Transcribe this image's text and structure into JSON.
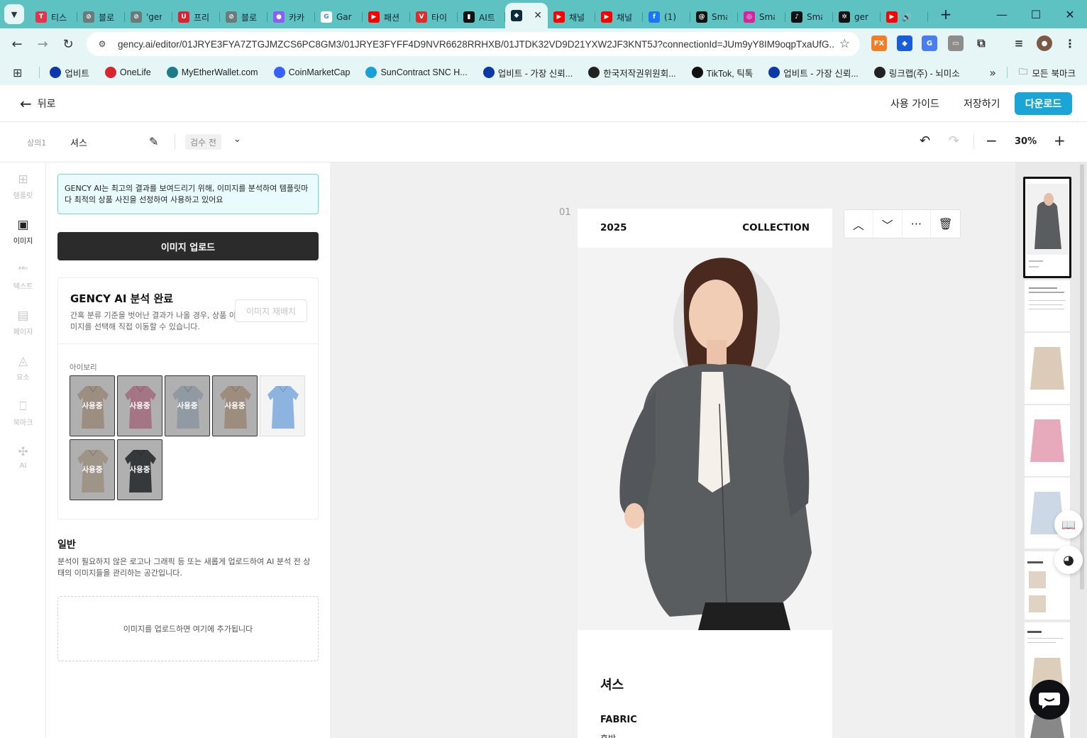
{
  "browser": {
    "tabs": [
      {
        "title": "티스",
        "color": "#e5344a",
        "glyph": "T"
      },
      {
        "title": "블로",
        "color": "#6b7b7b",
        "glyph": "⊘"
      },
      {
        "title": "'ger",
        "color": "#6b7b7b",
        "glyph": "⊘"
      },
      {
        "title": "프리",
        "color": "#e0202e",
        "glyph": "U"
      },
      {
        "title": "블로",
        "color": "#6b7b7b",
        "glyph": "⊘"
      },
      {
        "title": "카카",
        "color": "#8b5cf6",
        "glyph": "●"
      },
      {
        "title": "Gar",
        "color": "#ffffff",
        "glyph": "G"
      },
      {
        "title": "패션",
        "color": "#ff0000",
        "glyph": "▶"
      },
      {
        "title": "타이",
        "color": "#e02b2b",
        "glyph": "V"
      },
      {
        "title": "AI트",
        "color": "#111111",
        "glyph": "▮"
      },
      {
        "title": "",
        "color": "#0a2b3b",
        "glyph": "◆",
        "active": true
      },
      {
        "title": "채널",
        "color": "#ff0000",
        "glyph": "▶"
      },
      {
        "title": "채널",
        "color": "#ff0000",
        "glyph": "▶"
      },
      {
        "title": "(1)",
        "color": "#1877f2",
        "glyph": "f"
      },
      {
        "title": "Sma",
        "color": "#111111",
        "glyph": "@"
      },
      {
        "title": "Sma",
        "color": "#d6249f",
        "glyph": "◎"
      },
      {
        "title": "Sma",
        "color": "#111111",
        "glyph": "♪"
      },
      {
        "title": "ger",
        "color": "#111111",
        "glyph": "✲"
      },
      {
        "title": "",
        "color": "#ff0000",
        "glyph": "▶",
        "audio": true
      }
    ],
    "url": "gency.ai/editor/01JRYE3FYA7ZTGJMZCS6PC8GM3/01JRYE3FYFF4D9NVR6628RRHXB/01JTDK32VD9D21YXW2JF3KNT5J?connectionId=JUm9yY8IM9oqpTxaUfG...",
    "bookmarks": [
      {
        "label": "업비트",
        "color": "#0b3aa8"
      },
      {
        "label": "OneLife",
        "color": "#d8262e"
      },
      {
        "label": "MyEtherWallet.com",
        "color": "#1c7d8a"
      },
      {
        "label": "CoinMarketCap",
        "color": "#3861fb"
      },
      {
        "label": "SunContract SNC H...",
        "color": "#1aa0d8"
      },
      {
        "label": "업비트 - 가장 신뢰...",
        "color": "#0b3aa8"
      },
      {
        "label": "한국저작권위원회...",
        "color": "#222222"
      },
      {
        "label": "TikTok, 틱톡",
        "color": "#111111"
      },
      {
        "label": "업비트 - 가장 신뢰...",
        "color": "#0b3aa8"
      },
      {
        "label": "링크랩(주) - 뇌미소",
        "color": "#222222"
      }
    ],
    "all_bookmarks": "모든 북마크"
  },
  "header": {
    "back_label": "뒤로",
    "guide_label": "사용 가이드",
    "save_label": "저장하기",
    "download_label": "다운로드",
    "accent": "#1aa5d6"
  },
  "toolbar": {
    "category": "상의1",
    "product_name": "셔스",
    "status": "검수 전",
    "zoom": "30%"
  },
  "rail": {
    "items": [
      {
        "label": "템플릿",
        "icon": "⊞"
      },
      {
        "label": "이미지",
        "icon": "▣",
        "active": true
      },
      {
        "label": "텍스트",
        "icon": "ᴬᴮᶜ"
      },
      {
        "label": "페이지",
        "icon": "▤"
      },
      {
        "label": "요소",
        "icon": "◬"
      },
      {
        "label": "북마크",
        "icon": "⎕"
      },
      {
        "label": "AI",
        "icon": "✣"
      }
    ]
  },
  "panel": {
    "notice": "GENCY AI는 최고의 결과를 보여드리기 위해, 이미지를 분석하여 템플릿마다 최적의 상품 사진을 선정하여 사용하고 있어요",
    "upload_label": "이미지 업로드",
    "analysis_title": "GENCY AI 분석 완료",
    "analysis_desc": "간혹 분류 기준을 벗어난 결과가 나올 경우, 상품 이미지를 선택해 직접 이동할 수 있습니다.",
    "rearrange_label": "이미지 재배치",
    "group_label": "아이보리",
    "in_use_label": "사용중",
    "thumbnails": [
      {
        "color": "#d9c7b4",
        "in_use": true
      },
      {
        "color": "#e3a3b7",
        "in_use": true
      },
      {
        "color": "#c9d4e2",
        "in_use": true
      },
      {
        "color": "#d8c4b0",
        "in_use": true
      },
      {
        "color": "#8db4e0",
        "in_use": false
      },
      {
        "color": "#ddcebd",
        "in_use": true
      },
      {
        "color": "#4b4f52",
        "in_use": true
      }
    ],
    "general_title": "일반",
    "general_desc": "분석이 필요하지 않은 로고나 그래픽 등 또는 새롭게 업로드하여 AI 분석 전 상태의 이미지들을 관리하는 공간입니다.",
    "dropzone_label": "이미지를 업로드하면 여기에 추가됩니다"
  },
  "canvas": {
    "page_number": "01",
    "year": "2025",
    "collection": "COLLECTION",
    "product_title": "셔스",
    "fabric_label": "FABRIC",
    "fabric_value": "혼방"
  }
}
